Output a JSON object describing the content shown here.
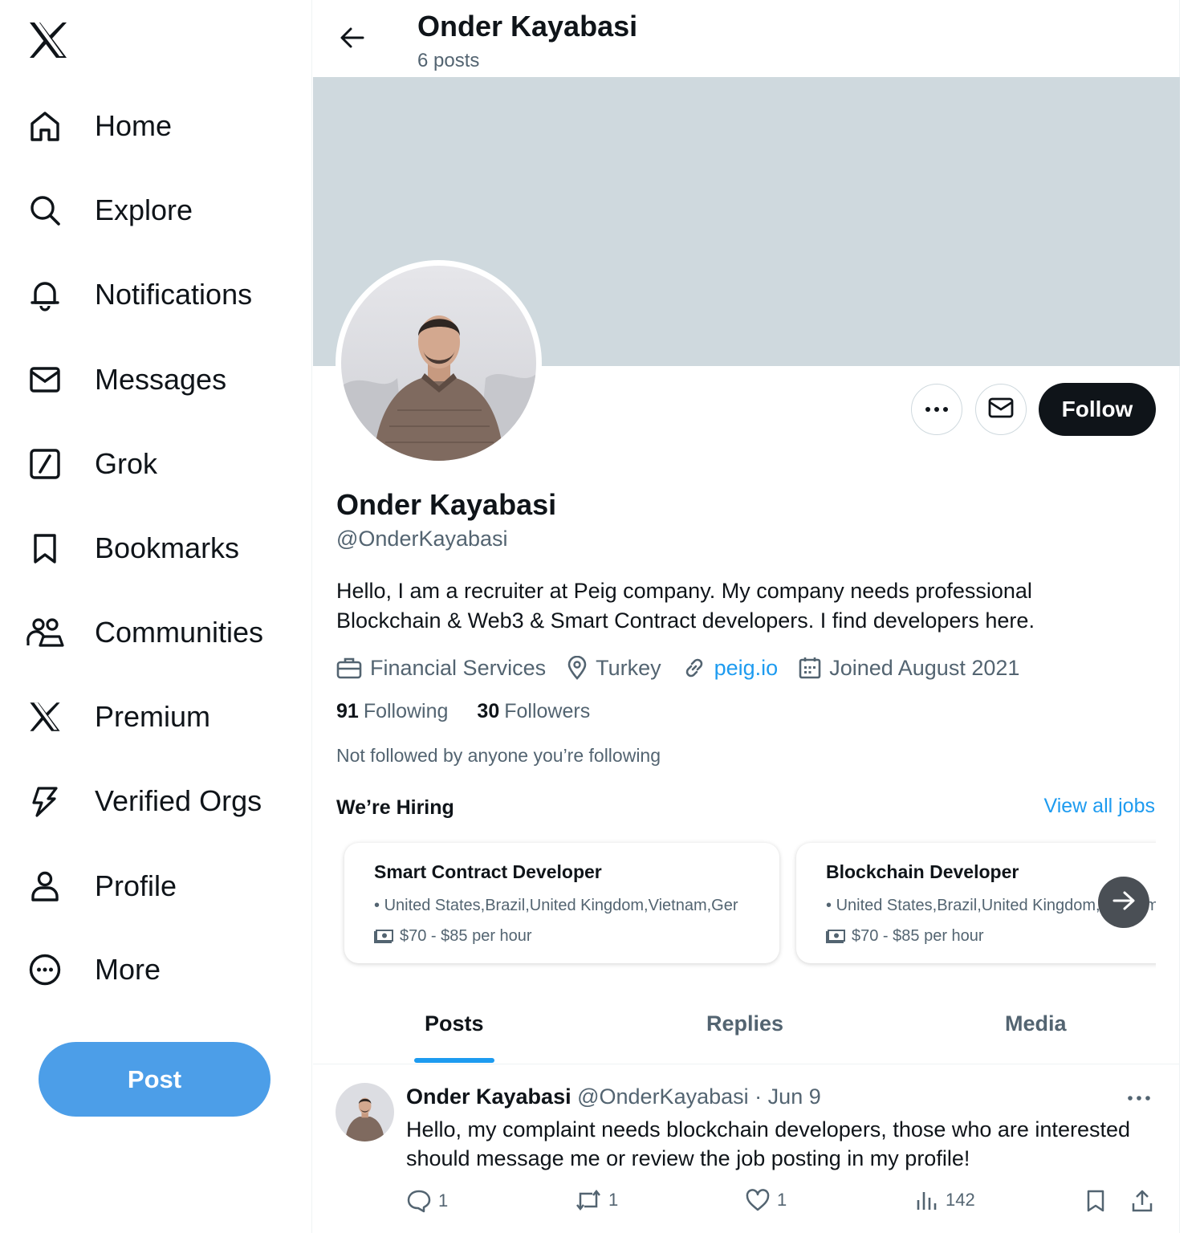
{
  "nav": {
    "items": [
      {
        "label": "Home",
        "icon": "home-icon"
      },
      {
        "label": "Explore",
        "icon": "search-icon"
      },
      {
        "label": "Notifications",
        "icon": "bell-icon"
      },
      {
        "label": "Messages",
        "icon": "envelope-icon"
      },
      {
        "label": "Grok",
        "icon": "grok-icon"
      },
      {
        "label": "Bookmarks",
        "icon": "bookmark-icon"
      },
      {
        "label": "Communities",
        "icon": "people-icon"
      },
      {
        "label": "Premium",
        "icon": "x-logo-icon"
      },
      {
        "label": "Verified Orgs",
        "icon": "lightning-icon"
      },
      {
        "label": "Profile",
        "icon": "person-icon"
      },
      {
        "label": "More",
        "icon": "more-circle-icon"
      }
    ],
    "post_label": "Post"
  },
  "header": {
    "name": "Onder Kayabasi",
    "posts_count": "6 posts"
  },
  "profile": {
    "name": "Onder Kayabasi",
    "handle": "@OnderKayabasi",
    "bio": "Hello, I am a recruiter at Peig company. My company needs professional Blockchain & Web3 & Smart Contract developers. I find developers here.",
    "category": "Financial Services",
    "location": "Turkey",
    "website": "peig.io",
    "joined": "Joined August 2021",
    "following_count": "91",
    "following_label": "Following",
    "followers_count": "30",
    "followers_label": "Followers",
    "not_followed": "Not followed by anyone you’re following",
    "follow_label": "Follow"
  },
  "hiring": {
    "title": "We’re Hiring",
    "view_all": "View all jobs",
    "jobs": [
      {
        "title": "Smart Contract Developer",
        "locations": "United States,Brazil,United Kingdom,Vietnam,Ger",
        "pay": "$70 - $85 per hour"
      },
      {
        "title": "Blockchain Developer",
        "locations": "United States,Brazil,United Kingdom,Vietnam,Germa",
        "pay": "$70 - $85 per hour"
      }
    ]
  },
  "tabs": [
    {
      "label": "Posts",
      "active": true
    },
    {
      "label": "Replies",
      "active": false
    },
    {
      "label": "Media",
      "active": false
    }
  ],
  "tweet": {
    "name": "Onder Kayabasi",
    "handle": "@OnderKayabasi",
    "separator": "·",
    "date": "Jun 9",
    "text": "Hello, my complaint needs blockchain developers, those who are interested should message me or review the job posting in my profile!",
    "replies": "1",
    "reposts": "1",
    "likes": "1",
    "views": "142"
  },
  "colors": {
    "accent": "#1d9bf0",
    "post_button": "#4c9ee8",
    "banner": "#cfd9de",
    "text": "#0f1419",
    "muted": "#536471"
  }
}
